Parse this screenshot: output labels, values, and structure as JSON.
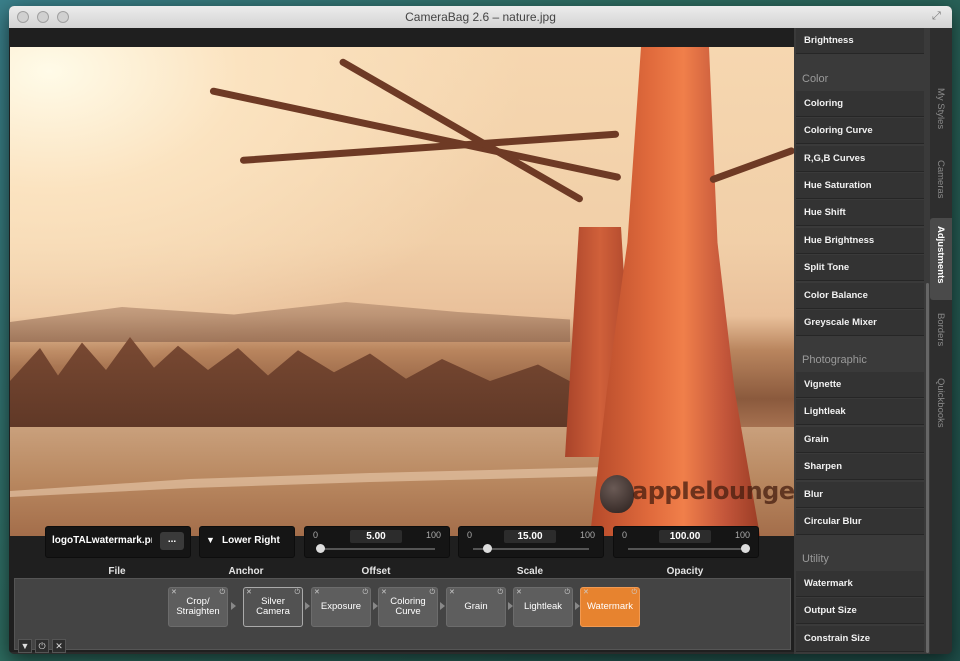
{
  "window": {
    "title": "CameraBag 2.6 – nature.jpg"
  },
  "photo": {
    "watermark_text": "appIelounge"
  },
  "controls": {
    "file": {
      "value": "logoTALwatermark.png",
      "button": "...",
      "label": "File"
    },
    "anchor": {
      "value": "Lower Right",
      "label": "Anchor"
    },
    "offset": {
      "min": "0",
      "max": "100",
      "value": "5.00",
      "label": "Offset",
      "level": 0.05
    },
    "scale": {
      "min": "0",
      "max": "100",
      "value": "15.00",
      "label": "Scale",
      "level": 0.15
    },
    "opacity": {
      "min": "0",
      "max": "100",
      "value": "100.00",
      "label": "Opacity",
      "level": 1.0
    }
  },
  "stack": {
    "steps": [
      {
        "label": "Crop/ Straighten",
        "state": "normal"
      },
      {
        "label": "Silver Camera",
        "state": "light"
      },
      {
        "label": "Exposure",
        "state": "normal"
      },
      {
        "label": "Coloring Curve",
        "state": "normal"
      },
      {
        "label": "Grain",
        "state": "normal"
      },
      {
        "label": "Lightleak",
        "state": "normal"
      },
      {
        "label": "Watermark",
        "state": "active"
      }
    ]
  },
  "panel": {
    "top_item": "Brightness",
    "sections": [
      {
        "title": "Color",
        "items": [
          "Coloring",
          "Coloring Curve",
          "R,G,B Curves",
          "Hue Saturation",
          "Hue Shift",
          "Hue Brightness",
          "Split Tone",
          "Color Balance",
          "Greyscale Mixer"
        ]
      },
      {
        "title": "Photographic",
        "items": [
          "Vignette",
          "Lightleak",
          "Grain",
          "Sharpen",
          "Blur",
          "Circular Blur"
        ]
      },
      {
        "title": "Utility",
        "items": [
          "Watermark",
          "Output Size",
          "Constrain Size"
        ]
      }
    ],
    "tabs": [
      "My Styles",
      "Cameras",
      "Adjustments",
      "Borders",
      "Quickbooks"
    ],
    "active_tab": "Adjustments"
  },
  "colors": {
    "accent": "#e7832f",
    "panel_bg": "#3a3a3a"
  }
}
